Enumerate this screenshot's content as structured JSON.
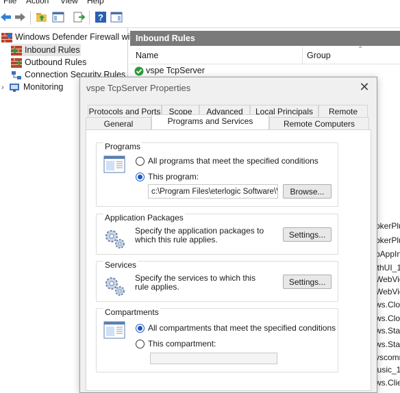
{
  "menu": {
    "file": "File",
    "action": "Action",
    "view": "View",
    "help": "Help"
  },
  "tree": {
    "root": "Windows Defender Firewall with",
    "items": [
      "Inbound Rules",
      "Outbound Rules",
      "Connection Security Rules",
      "Monitoring"
    ]
  },
  "pane": {
    "header": "Inbound Rules",
    "columns": {
      "name": "Name",
      "group": "Group"
    },
    "rule": "vspe TcpServer",
    "partial_rows": [
      "okerPlu",
      "okerPlu",
      "pAppIn",
      "lthUI_1",
      "WebVie",
      "WebVie",
      "ws.Clou",
      "ws.Clou",
      "ws.Star",
      "ws.Star",
      "vscomn",
      "lusic_1",
      "ws.Clie"
    ]
  },
  "dialog": {
    "title": "vspe TcpServer Properties",
    "tabs_row1": [
      "Protocols and Ports",
      "Scope",
      "Advanced",
      "Local Principals",
      "Remote Users"
    ],
    "tabs_row2": [
      "General",
      "Programs and Services",
      "Remote Computers"
    ],
    "programs": {
      "title": "Programs",
      "opt_all": "All programs that meet the specified conditions",
      "opt_this": "This program:",
      "path": "c:\\Program Files\\eterlogic Software\\Virt",
      "browse": "Browse..."
    },
    "packages": {
      "title": "Application Packages",
      "desc": "Specify the application packages to which this rule applies.",
      "settings": "Settings..."
    },
    "services": {
      "title": "Services",
      "desc": "Specify the services to which this rule applies.",
      "settings": "Settings..."
    },
    "compartments": {
      "title": "Compartments",
      "opt_all": "All compartments that meet the specified conditions",
      "opt_this": "This compartment:",
      "value": ""
    }
  }
}
